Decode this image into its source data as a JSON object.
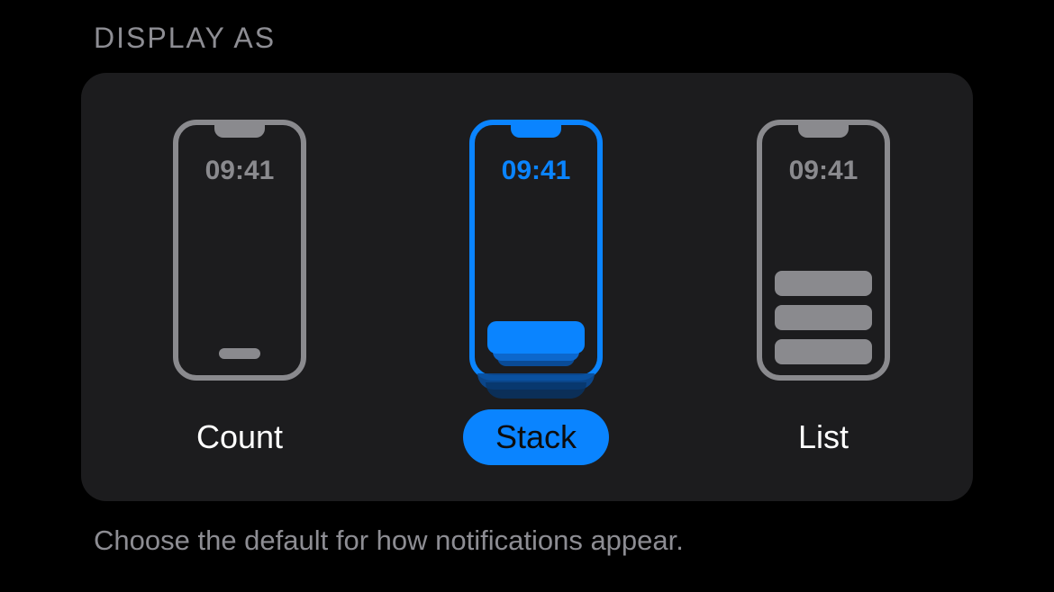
{
  "section_header": "DISPLAY AS",
  "phone_time": "09:41",
  "options": {
    "count": {
      "label": "Count",
      "selected": false
    },
    "stack": {
      "label": "Stack",
      "selected": true
    },
    "list": {
      "label": "List",
      "selected": false
    }
  },
  "footer": "Choose the default for how notifications appear.",
  "colors": {
    "accent": "#0a84ff",
    "inactive": "#8a8a8e",
    "card": "#1c1c1e",
    "background": "#000000",
    "secondary_text": "#8d8d93"
  }
}
